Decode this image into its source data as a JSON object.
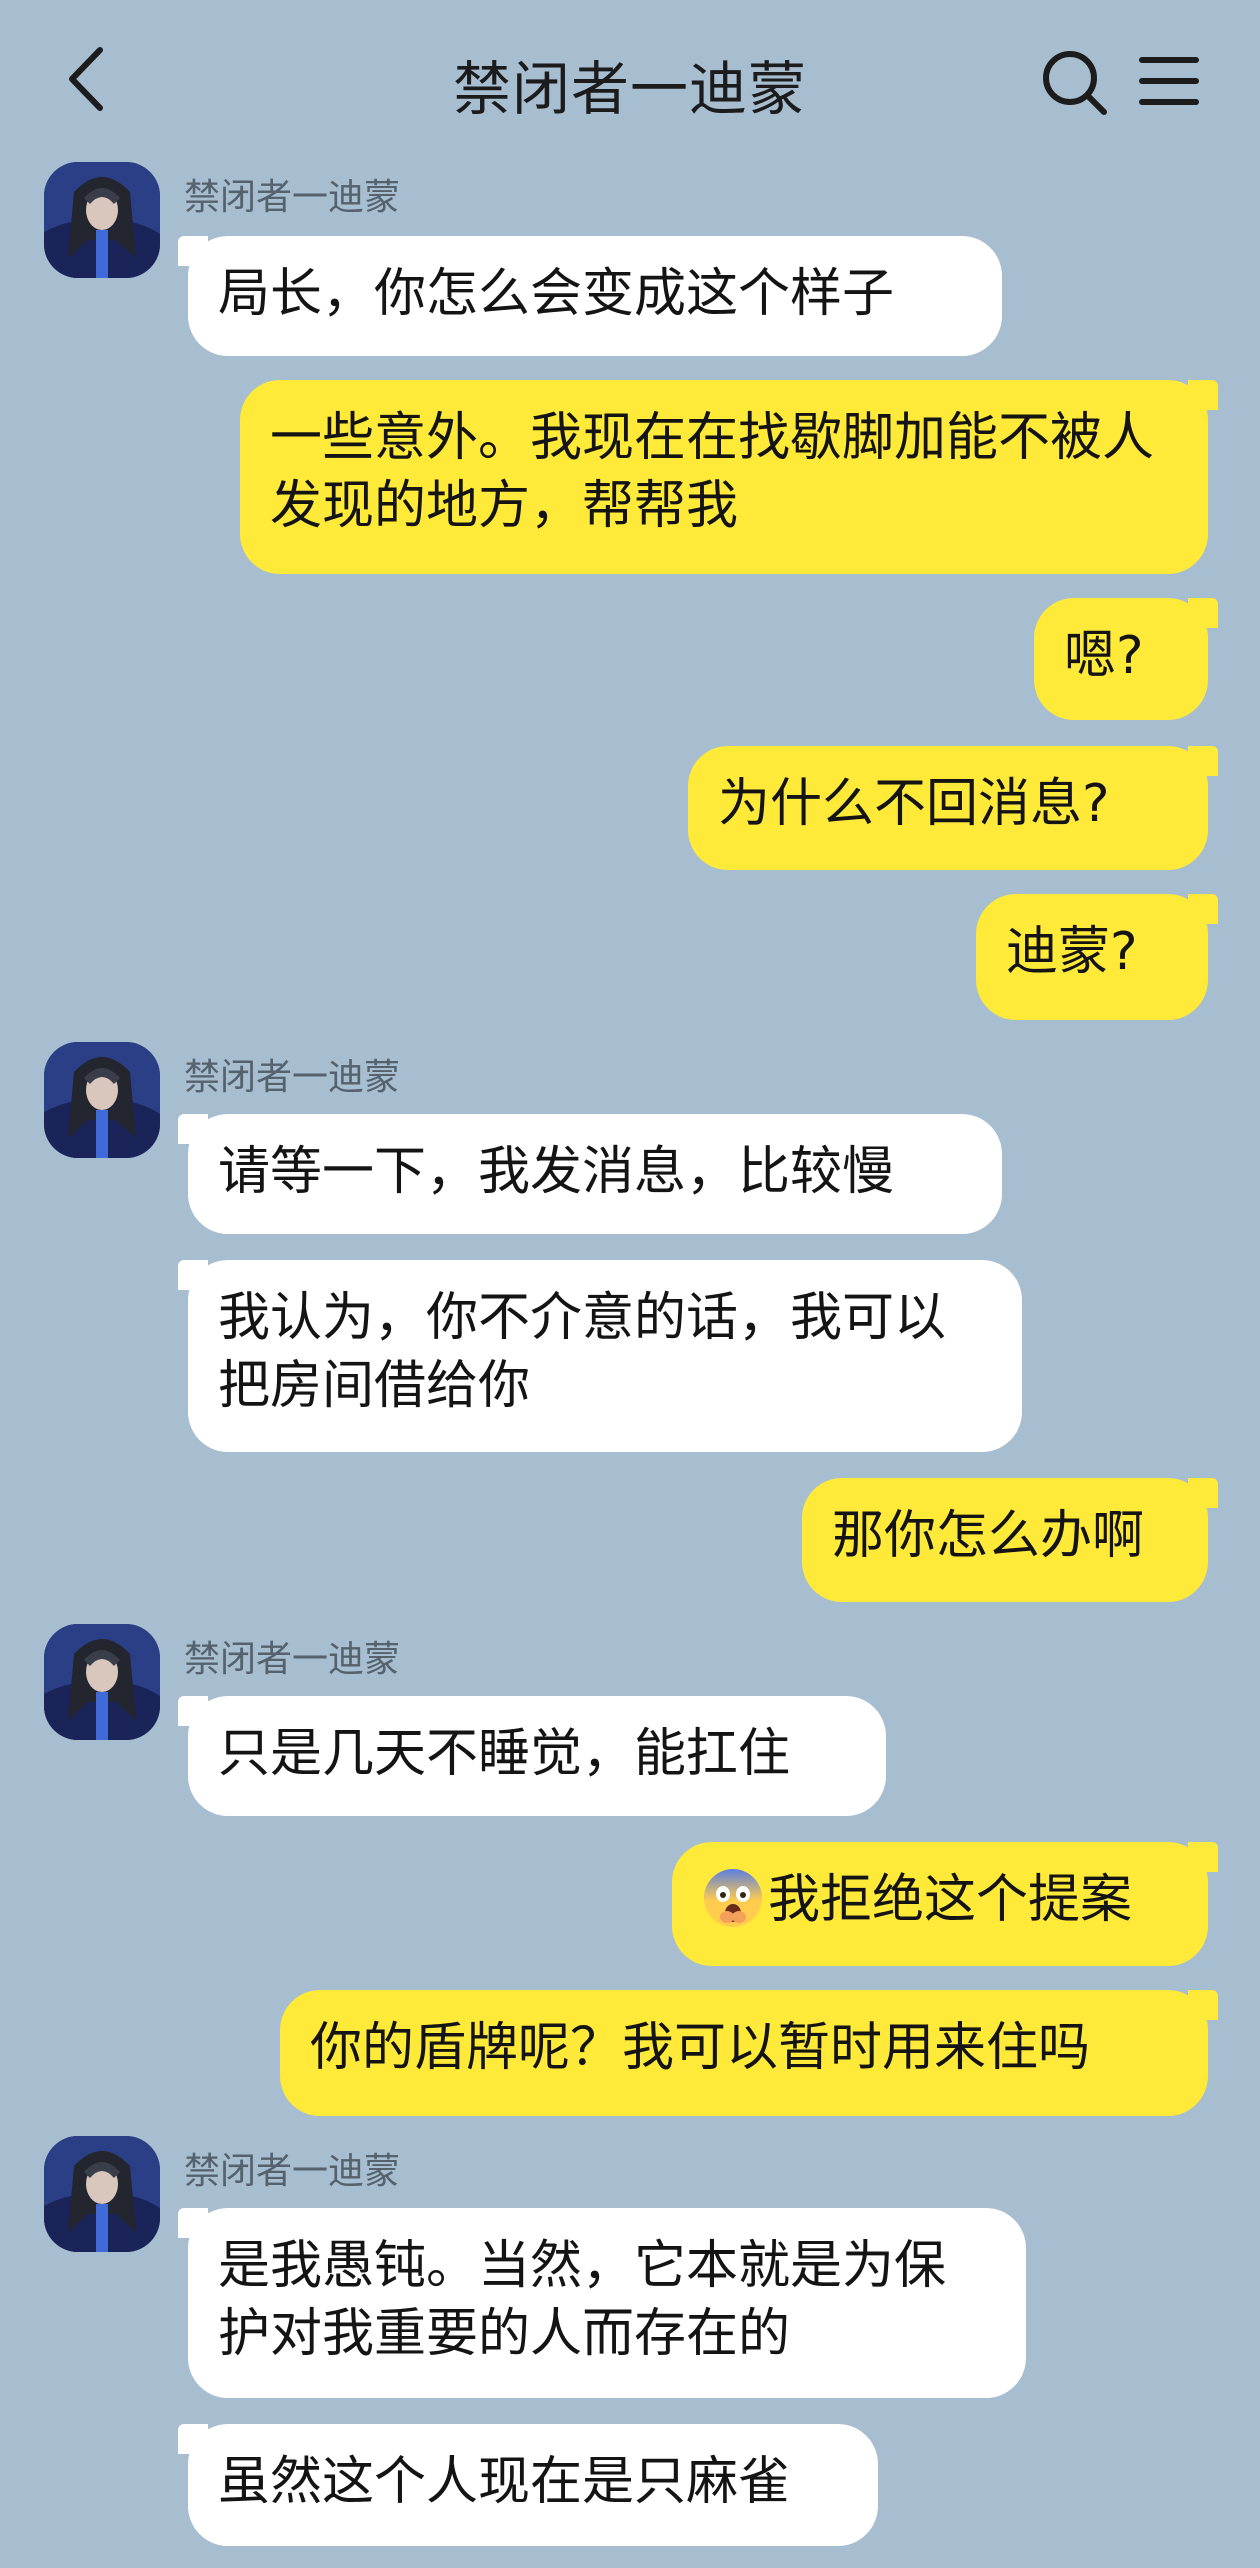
{
  "header": {
    "title": "禁闭者一迪蒙",
    "back_icon": "chevron-left-icon",
    "search_icon": "search-icon",
    "menu_icon": "hamburger-menu-icon"
  },
  "colors": {
    "background": "#a7bdd0",
    "incoming_bubble": "#ffffff",
    "outgoing_bubble": "#ffea3a"
  },
  "contact": {
    "name": "禁闭者一迪蒙"
  },
  "messages": [
    {
      "side": "left",
      "text": "局长，你怎么会变成这个样子"
    },
    {
      "side": "right",
      "text": "一些意外。我现在在找歇脚加能不被人发现的地方，帮帮我"
    },
    {
      "side": "right",
      "text": "嗯?"
    },
    {
      "side": "right",
      "text": "为什么不回消息?"
    },
    {
      "side": "right",
      "text": "迪蒙?"
    },
    {
      "side": "left",
      "text": "请等一下，我发消息，比较慢"
    },
    {
      "side": "left",
      "text": "我认为，你不介意的话，我可以把房间借给你"
    },
    {
      "side": "right",
      "text": "那你怎么办啊"
    },
    {
      "side": "left",
      "text": "只是几天不睡觉，能扛住"
    },
    {
      "side": "right",
      "text": "我拒绝这个提案",
      "emoji": "fearful-face-emoji"
    },
    {
      "side": "right",
      "text": "你的盾牌呢？我可以暂时用来住吗"
    },
    {
      "side": "left",
      "text": "是我愚钝。当然，它本就是为保护对我重要的人而存在的"
    },
    {
      "side": "left",
      "text": "虽然这个人现在是只麻雀"
    }
  ]
}
